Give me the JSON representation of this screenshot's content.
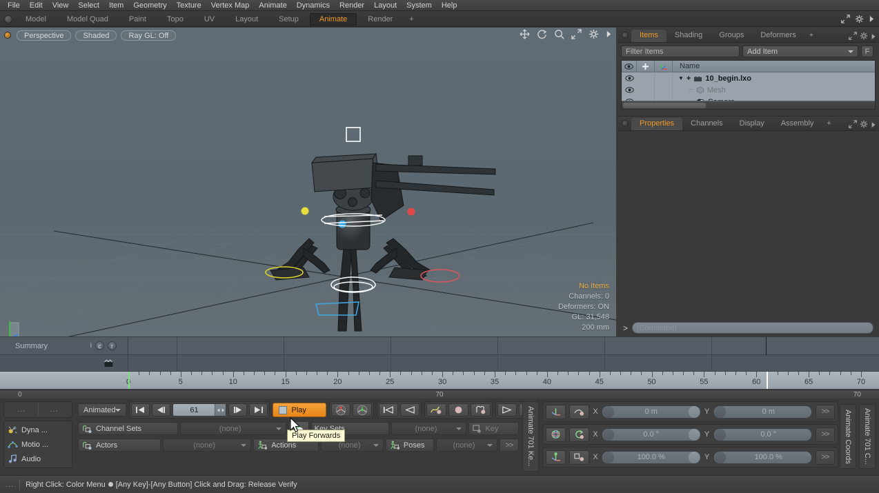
{
  "app": {
    "menu": [
      "File",
      "Edit",
      "View",
      "Select",
      "Item",
      "Geometry",
      "Texture",
      "Vertex Map",
      "Animate",
      "Dynamics",
      "Render",
      "Layout",
      "System",
      "Help"
    ],
    "mode_tabs": [
      {
        "label": "Model",
        "active": false
      },
      {
        "label": "Model Quad",
        "active": false
      },
      {
        "label": "Paint",
        "active": false
      },
      {
        "label": "Topo",
        "active": false
      },
      {
        "label": "UV",
        "active": false
      },
      {
        "label": "Layout",
        "active": false
      },
      {
        "label": "Setup",
        "active": false
      },
      {
        "label": "Animate",
        "active": true
      },
      {
        "label": "Render",
        "active": false
      },
      {
        "label": "+",
        "active": false
      }
    ]
  },
  "viewport": {
    "view_mode": "Perspective",
    "shading_mode": "Shaded",
    "raygl": "Ray GL: Off",
    "tools": [
      "move-icon",
      "rotate-icon",
      "zoom-icon",
      "fit-icon",
      "gear-icon",
      "play-arrow-icon"
    ],
    "info": {
      "no_items": "No Items",
      "channels": "Channels: 0",
      "deformers": "Deformers: ON",
      "gl": "GL: 31,548",
      "scale": "200 mm"
    }
  },
  "items_panel": {
    "tabs": [
      {
        "label": "Items",
        "active": true
      },
      {
        "label": "Shading",
        "active": false
      },
      {
        "label": "Groups",
        "active": false
      },
      {
        "label": "Deformers",
        "active": false
      },
      {
        "label": "+",
        "active": false
      }
    ],
    "filter_placeholder": "Filter Items",
    "add_item_label": "Add Item",
    "f_button": "F",
    "column_header": "Name",
    "rows": [
      {
        "name": "10_begin.lxo",
        "indent": 0,
        "style": "bold",
        "icon": "scene-icon"
      },
      {
        "name": "Mesh",
        "indent": 1,
        "style": "dim",
        "icon": "mesh-icon"
      },
      {
        "name": "Camera",
        "indent": 1,
        "style": "normal",
        "icon": "camera-icon"
      }
    ]
  },
  "properties_panel": {
    "tabs": [
      {
        "label": "Properties",
        "active": true
      },
      {
        "label": "Channels",
        "active": false
      },
      {
        "label": "Display",
        "active": false
      },
      {
        "label": "Assembly",
        "active": false
      },
      {
        "label": "+",
        "active": false
      }
    ],
    "command_placeholder": "(Command)",
    "command_prefix": ">"
  },
  "timeline": {
    "summary_label": "Summary",
    "badges": [
      "i",
      "c",
      "r"
    ],
    "range_start": "0",
    "range_end": "70",
    "range_mid": "70",
    "ticks": [
      0,
      5,
      10,
      15,
      20,
      25,
      30,
      35,
      40,
      45,
      50,
      55,
      60,
      65,
      70
    ],
    "current_frame": 61,
    "start_marker_frame": 0
  },
  "bottom_bar": {
    "left_items": [
      {
        "label": "Dyna ...",
        "icon": "dynamics-icon"
      },
      {
        "label": "Motio ...",
        "icon": "motion-icon"
      },
      {
        "label": "Audio",
        "icon": "audio-icon"
      }
    ],
    "dots_left": "...",
    "dots_right": "...",
    "mode_dropdown": "Animated",
    "frame_value": "61",
    "play_button": "Play",
    "tooltip": "Play Forwards",
    "transport": [
      "first-frame-icon",
      "prev-frame-icon",
      "next-frame-icon",
      "last-frame-icon"
    ],
    "key_buttons": [
      "key-up-icon",
      "key-down-icon",
      "prev-key-icon",
      "prev-key-end-icon",
      "curve-key-icon",
      "ellipse-key-icon",
      "range-key-icon",
      "next-key-icon",
      "next-key-end-icon"
    ],
    "channel_sets_label": "Channel Sets",
    "channel_sets_value": "(none)",
    "key_sets_label": "Key Sets",
    "key_sets_value": "(none)",
    "key_label": "Key",
    "actors_label": "Actors",
    "actors_value": "(none)",
    "actions_label": "Actions",
    "actions_value": "(none)",
    "poses_label": "Poses",
    "poses_value": "(none)",
    "more_label": ">>",
    "vtab_keyframes": "Animate 701 Ke...",
    "vtab_coords": "Animate Coords",
    "vtab_coords2": "Animate 701 C...",
    "transform_rows": [
      {
        "icon": "position-icon",
        "sub_icon": "pos-sub-icon",
        "x_label": "X",
        "x_value": "0 m",
        "y_label": "Y",
        "y_value": "0 m",
        "more": ">>"
      },
      {
        "icon": "rotation-icon",
        "sub_icon": "rot-sub-icon",
        "x_label": "X",
        "x_value": "0.0 °",
        "y_label": "Y",
        "y_value": "0.0 °",
        "more": ">>"
      },
      {
        "icon": "scale-icon",
        "sub_icon": "scl-sub-icon",
        "x_label": "X",
        "x_value": "100.0 %",
        "y_label": "Y",
        "y_value": "100.0 %",
        "more": ">>"
      }
    ]
  },
  "status_bar": {
    "dots": "...",
    "text_before": "Right Click: Color Menu",
    "text_after": "[Any Key]-[Any Button] Click and Drag: Release Verify"
  },
  "colors": {
    "accent": "#f09a28",
    "viewport_bg": "#5c6870",
    "panel_bg": "#3a3a3a",
    "timeline_bg": "#49525a",
    "play_highlight": "#e8861b"
  }
}
